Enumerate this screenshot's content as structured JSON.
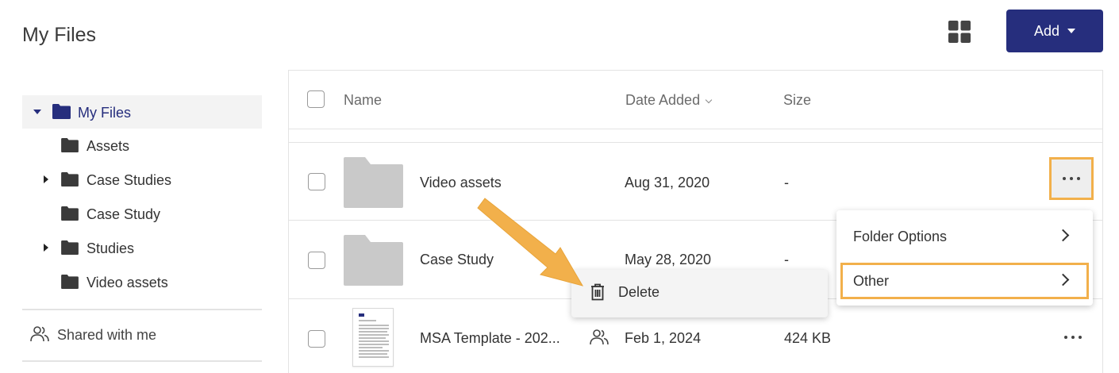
{
  "page": {
    "title": "My Files"
  },
  "toolbar": {
    "add_label": "Add",
    "grid_icon": "grid-view-icon"
  },
  "sidebar": {
    "tree": [
      {
        "label": "My Files",
        "expanded": true,
        "active": true
      },
      {
        "label": "Assets"
      },
      {
        "label": "Case Studies",
        "collapsed": true
      },
      {
        "label": "Case Study"
      },
      {
        "label": "Studies",
        "collapsed": true
      },
      {
        "label": "Video assets"
      }
    ],
    "shared_label": "Shared with me"
  },
  "table": {
    "columns": {
      "name": "Name",
      "date_added": "Date Added",
      "size": "Size"
    },
    "rows": [
      {
        "name": "Video assets",
        "date": "Aug 31, 2020",
        "size": "-",
        "type": "folder"
      },
      {
        "name": "Case Study",
        "date": "May 28, 2020",
        "size": "-",
        "type": "folder"
      },
      {
        "name": "MSA Template - 202...",
        "date": "Feb 1, 2024",
        "size": "424 KB",
        "type": "document",
        "shared": true
      }
    ]
  },
  "context_menu": {
    "items": [
      {
        "label": "Folder Options"
      },
      {
        "label": "Other"
      }
    ]
  },
  "submenu": {
    "label": "Delete",
    "icon": "trash-icon"
  },
  "colors": {
    "accent": "#262e7d",
    "highlight": "#f2b04b",
    "folder": "#c9c9c9"
  }
}
